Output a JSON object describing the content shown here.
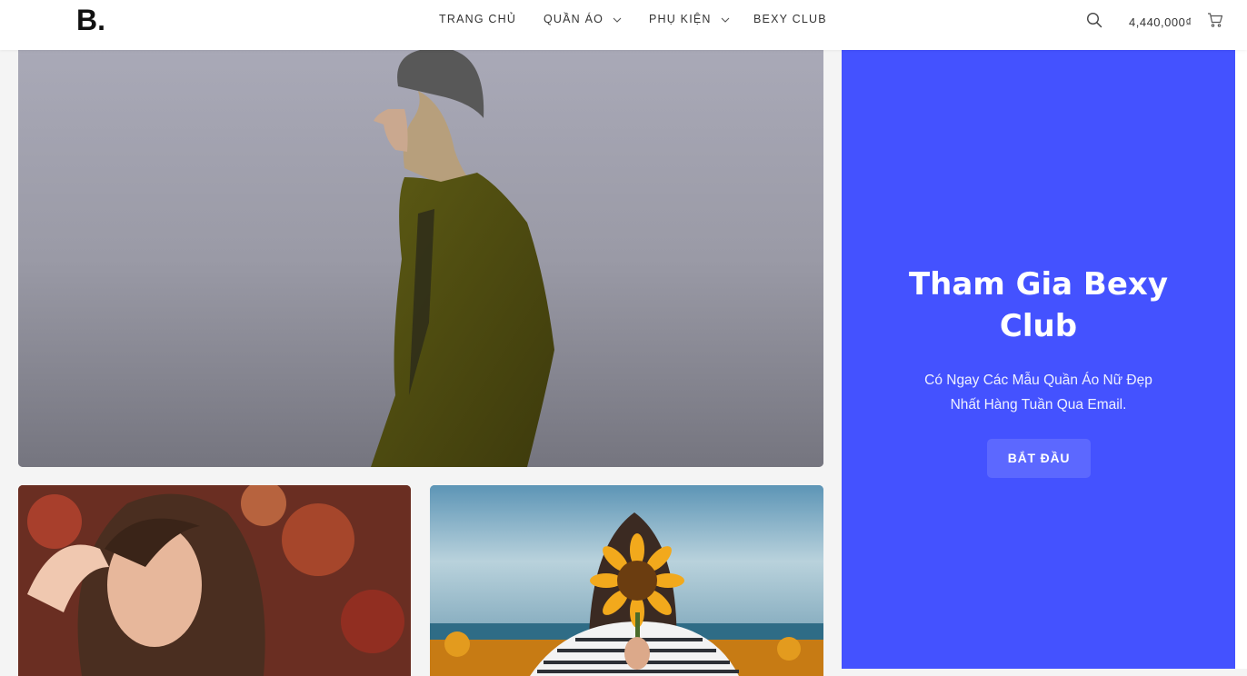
{
  "header": {
    "logo": "B.",
    "nav": [
      {
        "label": "TRANG CHỦ",
        "has_dropdown": false
      },
      {
        "label": "QUẦN ÁO",
        "has_dropdown": true
      },
      {
        "label": "PHỤ KIỆN",
        "has_dropdown": true
      },
      {
        "label": "BEXY CLUB",
        "has_dropdown": false
      }
    ],
    "cart_total": "4,440,000₫",
    "icons": {
      "search": "search-icon",
      "cart": "cart-icon",
      "dropdown": "chevron-down-icon"
    }
  },
  "promo": {
    "title_line1": "Tham Gia Bexy",
    "title_line2": "Club",
    "subtitle_line1": "Có Ngay Các Mẫu Quần Áo Nữ Đẹp",
    "subtitle_line2": "Nhất Hàng Tuần Qua Email.",
    "button_label": "BẮT ĐẦU"
  },
  "colors": {
    "promo_background": "#4452ff",
    "promo_button": "#5c68ff",
    "header_background": "#ffffff",
    "page_background": "#f4f4f4"
  }
}
